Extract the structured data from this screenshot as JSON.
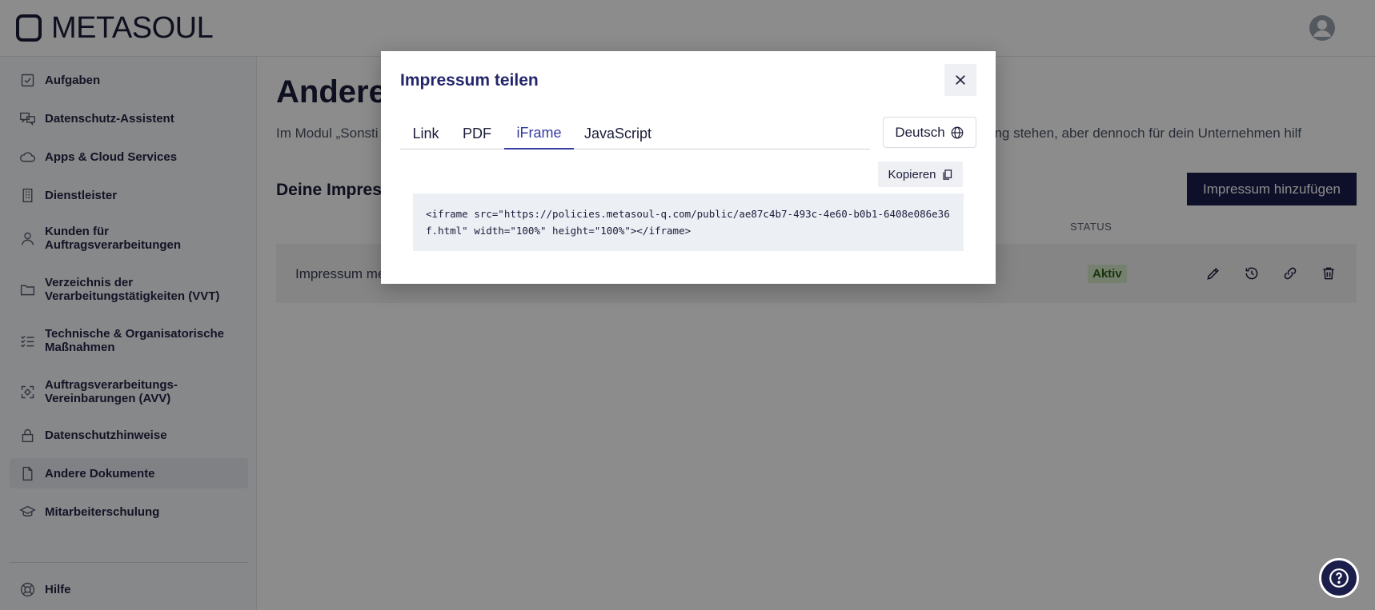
{
  "app": {
    "logo_text": "METASOUL"
  },
  "sidebar": {
    "items": [
      {
        "label": "Aufgaben",
        "icon": "check-square-icon"
      },
      {
        "label": "Datenschutz-Assistent",
        "icon": "chat-assistant-icon"
      },
      {
        "label": "Apps & Cloud Services",
        "icon": "cloud-icon"
      },
      {
        "label": "Dienstleister",
        "icon": "building-icon"
      },
      {
        "label": "Kunden für Auftragsverarbeitungen",
        "icon": "person-icon"
      },
      {
        "label": "Verzeichnis der Verarbeitungstätigkeiten (VVT)",
        "icon": "folder-icon"
      },
      {
        "label": "Technische & Organisatorische Maßnahmen",
        "icon": "checklist-icon"
      },
      {
        "label": "Auftragsverarbeitungs-Vereinbarungen (AVV)",
        "icon": "contract-icon"
      },
      {
        "label": "Datenschutzhinweise",
        "icon": "lock-icon"
      },
      {
        "label": "Andere Dokumente",
        "icon": "document-icon"
      },
      {
        "label": "Mitarbeiterschulung",
        "icon": "graduation-cap-icon"
      }
    ],
    "help_label": "Hilfe"
  },
  "main": {
    "title": "Andere",
    "description": "Im Modul „Sonsti                                                                                                                                             Zusammenhang stehen, aber dennoch für dein Unternehmen hilf",
    "section_title": "Deine Impres",
    "add_button": "Impressum hinzufügen",
    "table": {
      "status_header": "STATUS",
      "rows": [
        {
          "name": "Impressum me",
          "status": "Aktiv"
        }
      ]
    }
  },
  "modal": {
    "title": "Impressum teilen",
    "tabs": [
      "Link",
      "PDF",
      "iFrame",
      "JavaScript"
    ],
    "active_tab": "iFrame",
    "language": "Deutsch",
    "copy_label": "Kopieren",
    "code": "<iframe src=\"https://policies.metasoul-q.com/public/ae87c4b7-493c-4e60-b0b1-6408e086e36f.html\" width=\"100%\" height=\"100%\"></iframe>"
  },
  "colors": {
    "brand_navy": "#1b1d4a",
    "active_tab": "#343ba3",
    "badge_bg": "#d6ebc8",
    "badge_text": "#2f5e16"
  }
}
